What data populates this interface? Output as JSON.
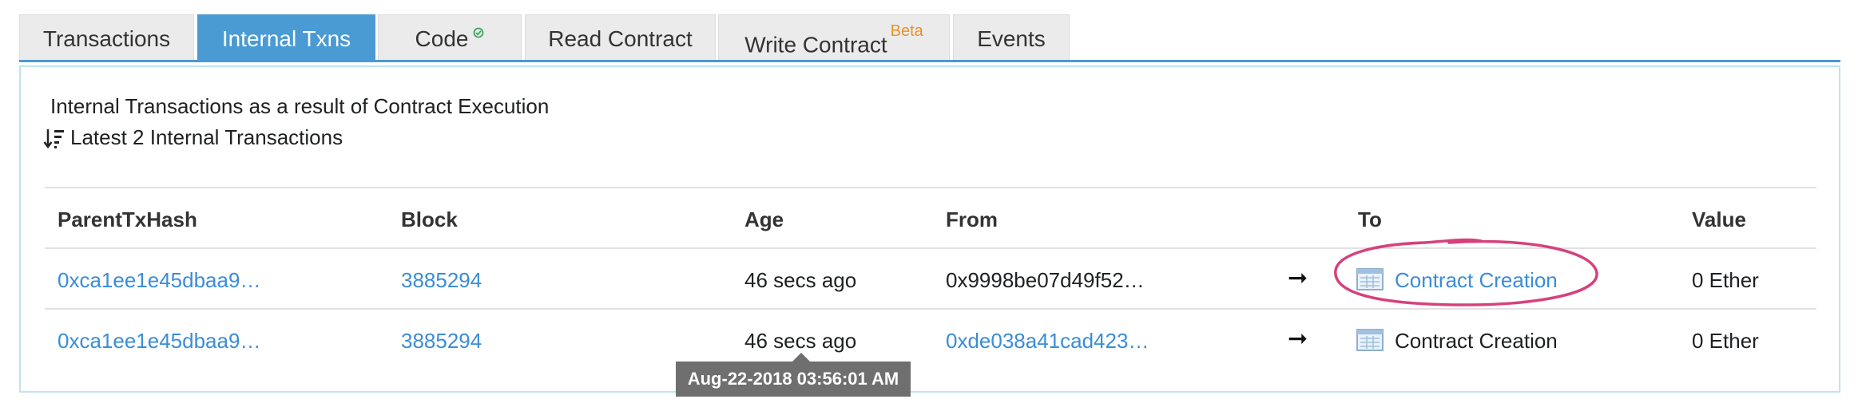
{
  "tabs": [
    {
      "label": "Transactions",
      "active": false
    },
    {
      "label": "Internal Txns",
      "active": true
    },
    {
      "label": "Code",
      "active": false
    },
    {
      "label": "Read Contract",
      "active": false
    },
    {
      "label": "Write Contract",
      "badge": "Beta",
      "active": false
    },
    {
      "label": "Events",
      "active": false
    }
  ],
  "panel": {
    "description": "Internal Transactions as a result of Contract Execution",
    "latest_label": "Latest 2 Internal Transactions"
  },
  "table": {
    "headers": [
      "ParentTxHash",
      "Block",
      "Age",
      "From",
      "To",
      "Value"
    ],
    "rows": [
      {
        "parent_tx_hash": "0xca1ee1e45dbaa9…",
        "block": "3885294",
        "age": "46 secs ago",
        "from": "0x9998be07d49f52…",
        "arrow": "➞",
        "to": "Contract Creation",
        "value": "0 Ether"
      },
      {
        "parent_tx_hash": "0xca1ee1e45dbaa9…",
        "block": "3885294",
        "age": "46 secs ago",
        "from": "0xde038a41cad423…",
        "arrow": "➞",
        "to": "Contract Creation",
        "value": "0 Ether"
      }
    ]
  },
  "tooltip": {
    "text": "Aug-22-2018 03:56:01 AM"
  },
  "colors": {
    "accent": "#4a9ad4",
    "link": "#3a8dd8",
    "beta": "#e8912b",
    "verified": "#3aa55d",
    "annotation": "#d6417d",
    "tooltip_bg": "#6f6f6f"
  },
  "icons": {
    "verified": "check-circle-icon",
    "sort": "sort-descending-icon",
    "arrow": "arrow-right-icon",
    "contract": "contract-creation-icon"
  }
}
